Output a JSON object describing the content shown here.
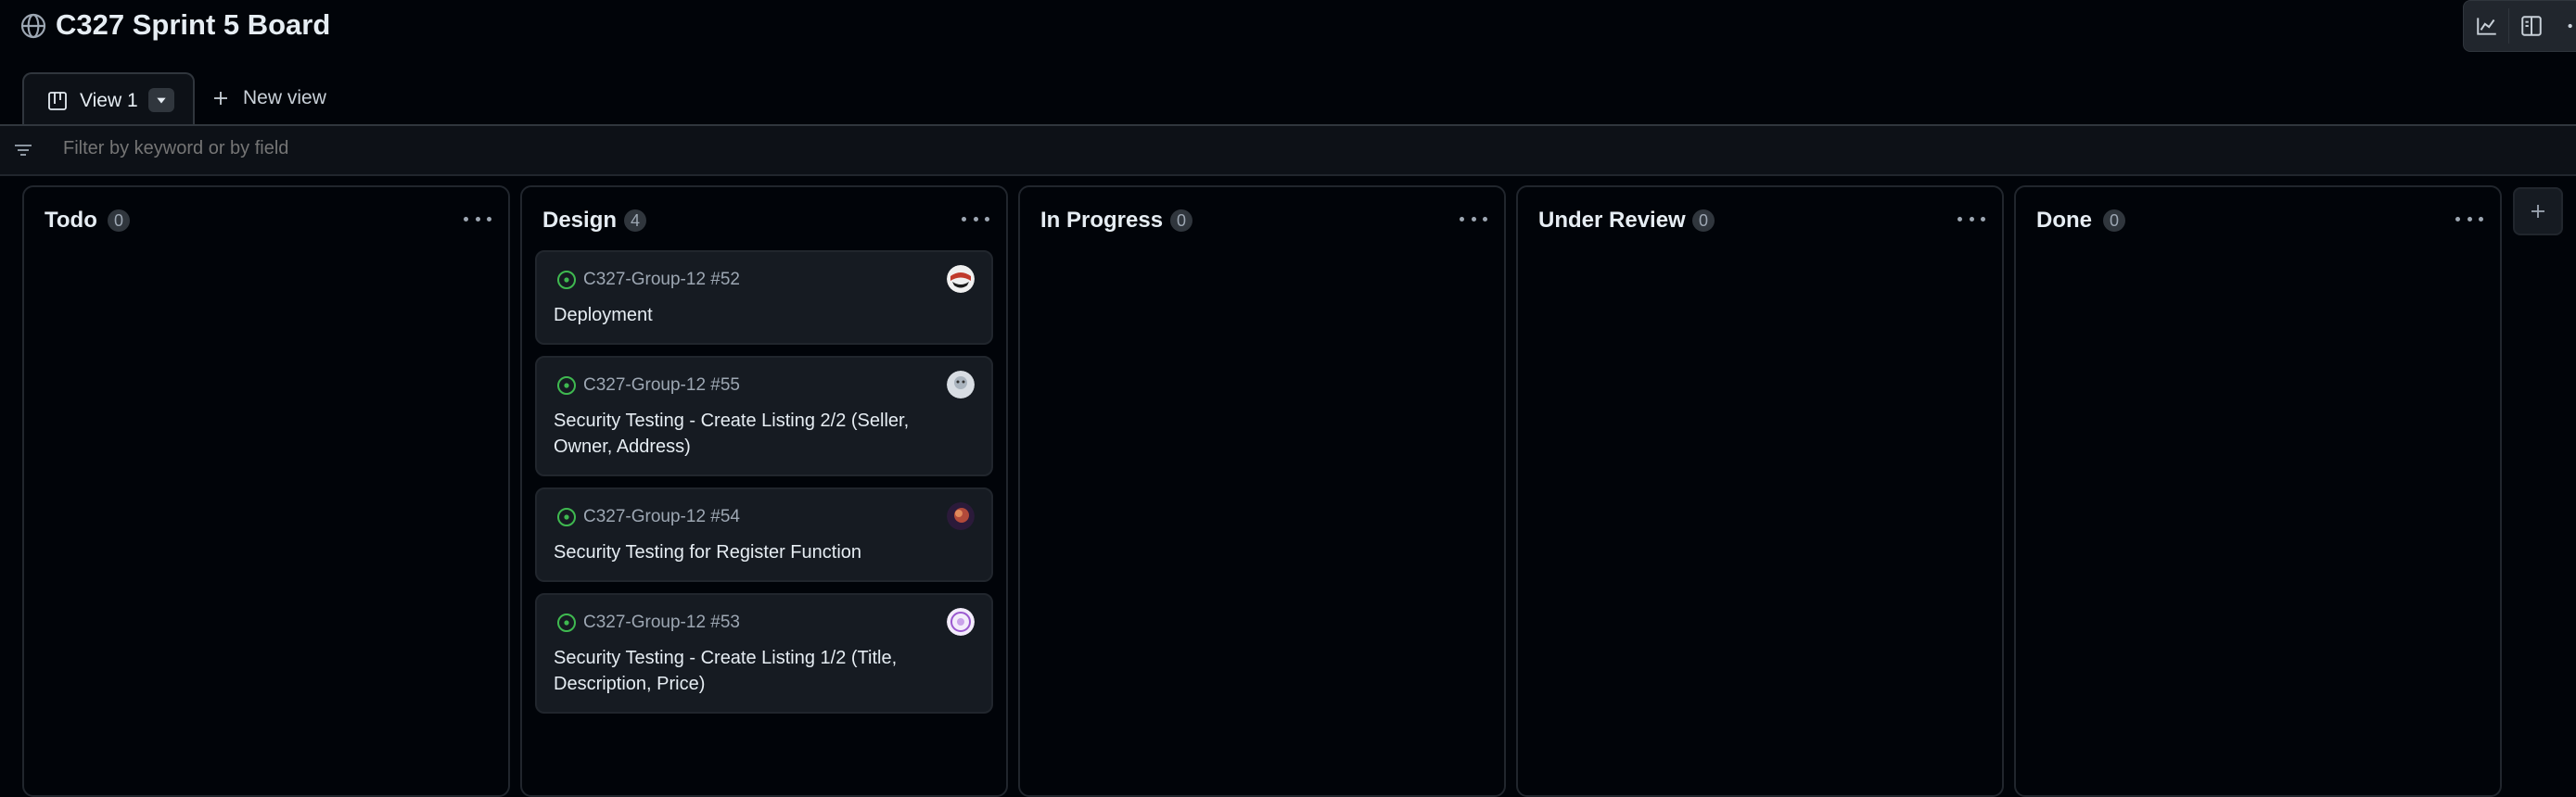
{
  "header": {
    "title": "C327 Sprint 5 Board",
    "icons": [
      "globe-icon",
      "insights-icon",
      "sidebar-toggle-icon",
      "more-icon"
    ]
  },
  "tabs": {
    "active": {
      "label": "View 1",
      "icon": "board-icon"
    },
    "new_view_label": "New view"
  },
  "filter": {
    "placeholder": "Filter by keyword or by field"
  },
  "columns": [
    {
      "title": "Todo",
      "count": "0"
    },
    {
      "title": "Design",
      "count": "4"
    },
    {
      "title": "In Progress",
      "count": "0"
    },
    {
      "title": "Under Review",
      "count": "0"
    },
    {
      "title": "Done",
      "count": "0"
    }
  ],
  "cards": [
    {
      "ref": "C327-Group-12 #52",
      "title": "Deployment",
      "status": "open"
    },
    {
      "ref": "C327-Group-12 #55",
      "title": "Security Testing - Create Listing 2/2 (Seller, Owner, Address)",
      "status": "open"
    },
    {
      "ref": "C327-Group-12 #54",
      "title": "Security Testing for Register Function",
      "status": "open"
    },
    {
      "ref": "C327-Group-12 #53",
      "title": "Security Testing - Create Listing 1/2 (Title, Description, Price)",
      "status": "open"
    }
  ],
  "colors": {
    "background": "#010409",
    "card": "#161b22",
    "border": "#21262d",
    "open_status": "#3fb950",
    "text": "#e6edf3",
    "muted": "#9da7b3"
  }
}
